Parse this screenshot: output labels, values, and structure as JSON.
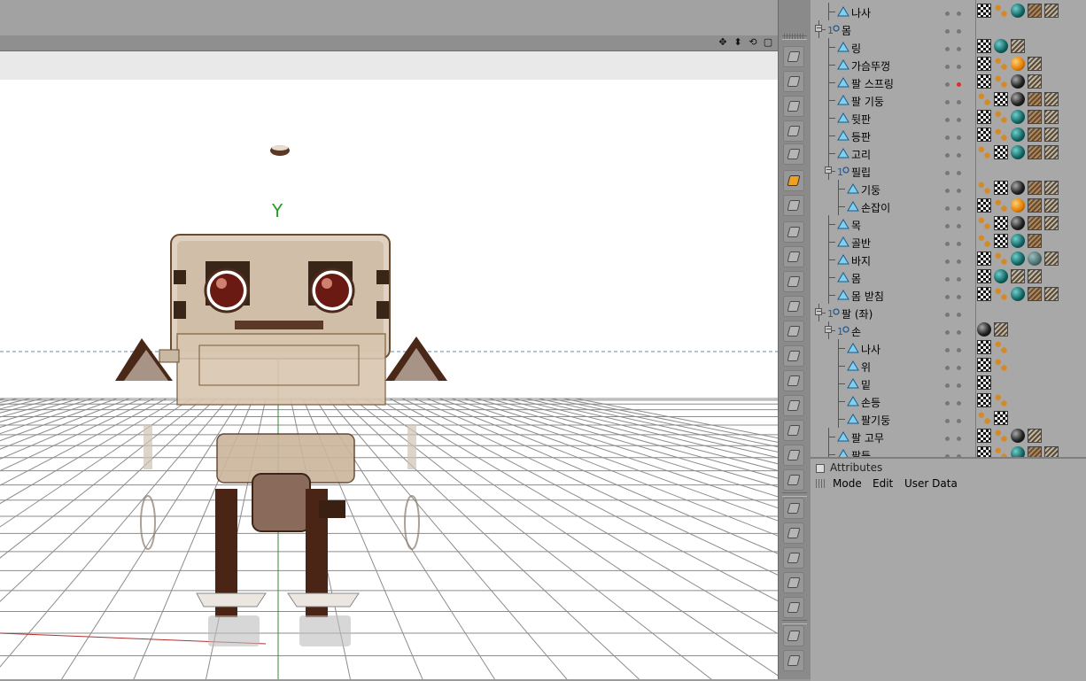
{
  "viewport": {
    "axis_label": "Y",
    "nav_icons": [
      "move-icon",
      "dolly-icon",
      "rotate-icon",
      "maximize-icon"
    ]
  },
  "toolbar": {
    "icons": [
      "move-tool-icon",
      "scale-tool-icon",
      "rotate-tool-icon",
      "model-mode-icon",
      "object-mode-icon",
      "texture-mode-icon",
      "axis-mode-icon",
      "points-mode-icon",
      "edges-mode-icon",
      "polygons-mode-icon",
      "uv-points-icon",
      "uv-polygons-icon",
      "snap-icon",
      "workplane-icon",
      "lock-icon",
      "solo-icon",
      "quantize-icon",
      "live-select-icon",
      "view-icon-1",
      "view-icon-2",
      "view-icon-3",
      "view-icon-4",
      "view-icon-5",
      "view-icon-6",
      "view-icon-7"
    ]
  },
  "objects": [
    {
      "name": "나사",
      "depth": 2,
      "type": "poly",
      "tags": [
        "tex",
        "uv",
        "sph-teal",
        "wood",
        "hatch"
      ]
    },
    {
      "name": "몸",
      "depth": 1,
      "type": "null",
      "expanded": true,
      "tags": []
    },
    {
      "name": "링",
      "depth": 2,
      "type": "poly",
      "tags": [
        "tex",
        "sph-teal",
        "hatch"
      ]
    },
    {
      "name": "가슴뚜껑",
      "depth": 2,
      "type": "poly",
      "tags": [
        "tex",
        "uv",
        "sph-orange",
        "hatch"
      ]
    },
    {
      "name": "팔 스프링",
      "depth": 2,
      "type": "poly",
      "red": true,
      "tags": [
        "tex",
        "uv",
        "sph-black",
        "hatch"
      ]
    },
    {
      "name": "팔 기둥",
      "depth": 2,
      "type": "poly",
      "tags": [
        "uv",
        "tex",
        "sph-black",
        "wood",
        "hatch"
      ]
    },
    {
      "name": "뒷판",
      "depth": 2,
      "type": "poly",
      "tags": [
        "tex",
        "uv",
        "sph-teal",
        "wood",
        "hatch"
      ]
    },
    {
      "name": "등판",
      "depth": 2,
      "type": "poly",
      "tags": [
        "tex",
        "uv",
        "sph-teal",
        "wood",
        "hatch"
      ]
    },
    {
      "name": "고리",
      "depth": 2,
      "type": "poly",
      "tags": [
        "uv",
        "tex",
        "sph-teal",
        "wood",
        "hatch"
      ]
    },
    {
      "name": "필립",
      "depth": 2,
      "type": "null",
      "expanded": true,
      "tags": []
    },
    {
      "name": "기둥",
      "depth": 3,
      "type": "poly",
      "tags": [
        "uv",
        "tex",
        "sph-black",
        "wood",
        "hatch"
      ]
    },
    {
      "name": "손잡이",
      "depth": 3,
      "type": "poly",
      "tags": [
        "tex",
        "uv",
        "sph-orange",
        "wood",
        "hatch"
      ]
    },
    {
      "name": "목",
      "depth": 2,
      "type": "poly",
      "tags": [
        "uv",
        "tex",
        "sph-black",
        "wood",
        "hatch"
      ]
    },
    {
      "name": "골반",
      "depth": 2,
      "type": "poly",
      "tags": [
        "uv",
        "tex",
        "sph-teal",
        "wood"
      ]
    },
    {
      "name": "바지",
      "depth": 2,
      "type": "poly",
      "tags": [
        "tex",
        "uv",
        "sph-teal",
        "sph-grey",
        "hatch"
      ]
    },
    {
      "name": "몸",
      "depth": 2,
      "type": "poly",
      "tags": [
        "tex",
        "sph-teal",
        "hatch",
        "hatch"
      ]
    },
    {
      "name": "몸 받침",
      "depth": 2,
      "type": "poly",
      "tags": [
        "tex",
        "uv",
        "sph-teal",
        "wood",
        "hatch"
      ]
    },
    {
      "name": "팔 (좌)",
      "depth": 1,
      "type": "null",
      "expanded": true,
      "tags": []
    },
    {
      "name": "손",
      "depth": 2,
      "type": "null",
      "expanded": true,
      "tags": [
        "sph-black",
        "hatch"
      ]
    },
    {
      "name": "나사",
      "depth": 3,
      "type": "poly",
      "tags": [
        "tex",
        "uv"
      ]
    },
    {
      "name": "위",
      "depth": 3,
      "type": "poly",
      "tags": [
        "tex",
        "uv"
      ]
    },
    {
      "name": "밑",
      "depth": 3,
      "type": "poly",
      "tags": [
        "tex"
      ]
    },
    {
      "name": "손등",
      "depth": 3,
      "type": "poly",
      "tags": [
        "tex",
        "uv"
      ]
    },
    {
      "name": "팔기둥",
      "depth": 3,
      "type": "poly",
      "tags": [
        "uv",
        "tex"
      ]
    },
    {
      "name": "팔 고무",
      "depth": 2,
      "type": "poly",
      "tags": [
        "tex",
        "uv",
        "sph-black",
        "hatch"
      ]
    },
    {
      "name": "팔등",
      "depth": 2,
      "type": "poly",
      "tags": [
        "tex",
        "uv",
        "sph-teal",
        "wood",
        "hatch"
      ]
    }
  ],
  "attributes": {
    "title": "Attributes",
    "menu": [
      "Mode",
      "Edit",
      "User Data"
    ]
  }
}
